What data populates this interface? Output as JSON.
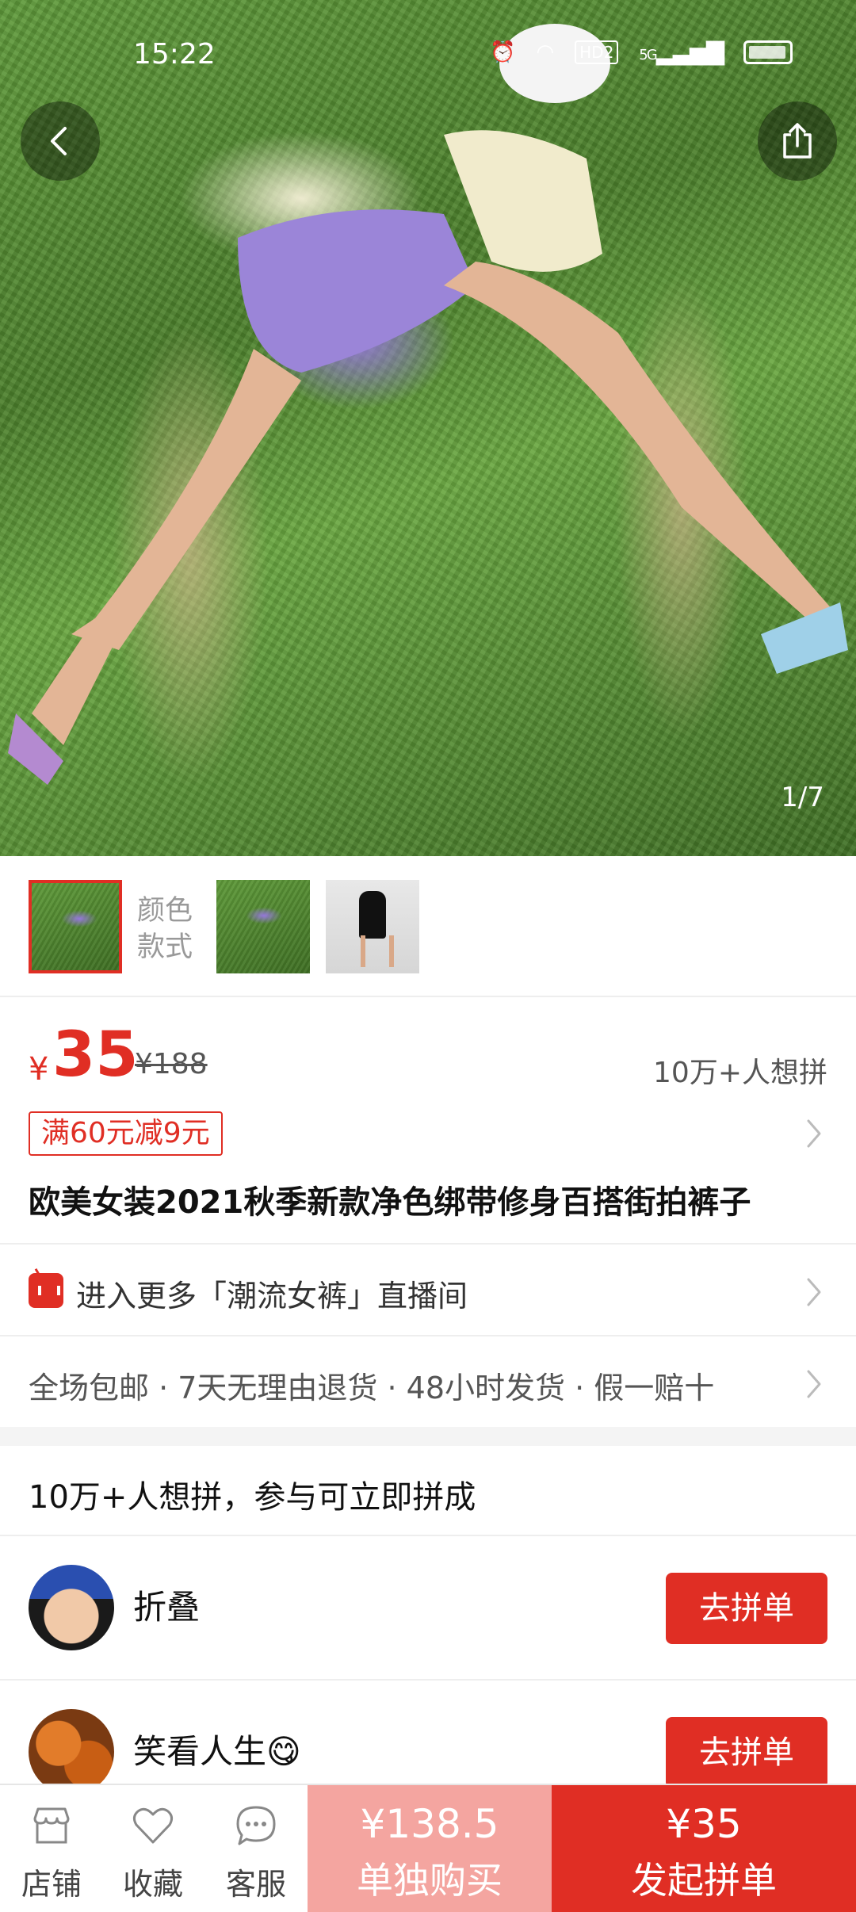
{
  "status_bar": {
    "time": "15:22",
    "hd": "HD2",
    "network": "5G"
  },
  "gallery": {
    "counter": "1/7"
  },
  "sku": {
    "style_label": "颜色款式"
  },
  "price": {
    "symbol": "¥",
    "current": "35",
    "original": "¥188",
    "want_count": "10万+人想拼"
  },
  "coupon": "满60元减9元",
  "product_title": "欧美女装2021秋季新款净色绑带修身百搭街拍裤子",
  "live_link": "进入更多「潮流女裤」直播间",
  "services": "全场包邮 · 7天无理由退货 · 48小时发货 · 假一赔十",
  "group": {
    "heading": "10万+人想拼，参与可立即拼成",
    "members": [
      {
        "name": "折叠",
        "button": "去拼单"
      },
      {
        "name": "笑看人生😋",
        "button": "去拼单"
      }
    ]
  },
  "bottom_bar": {
    "tabs": [
      {
        "label": "店铺",
        "icon": "store-icon"
      },
      {
        "label": "收藏",
        "icon": "heart-icon"
      },
      {
        "label": "客服",
        "icon": "chat-icon"
      }
    ],
    "solo": {
      "price": "¥138.5",
      "label": "单独购买"
    },
    "group_buy": {
      "price": "¥35",
      "label": "发起拼单"
    }
  },
  "colors": {
    "accent": "#e02e24",
    "solo_bg": "#f4a5a0"
  }
}
